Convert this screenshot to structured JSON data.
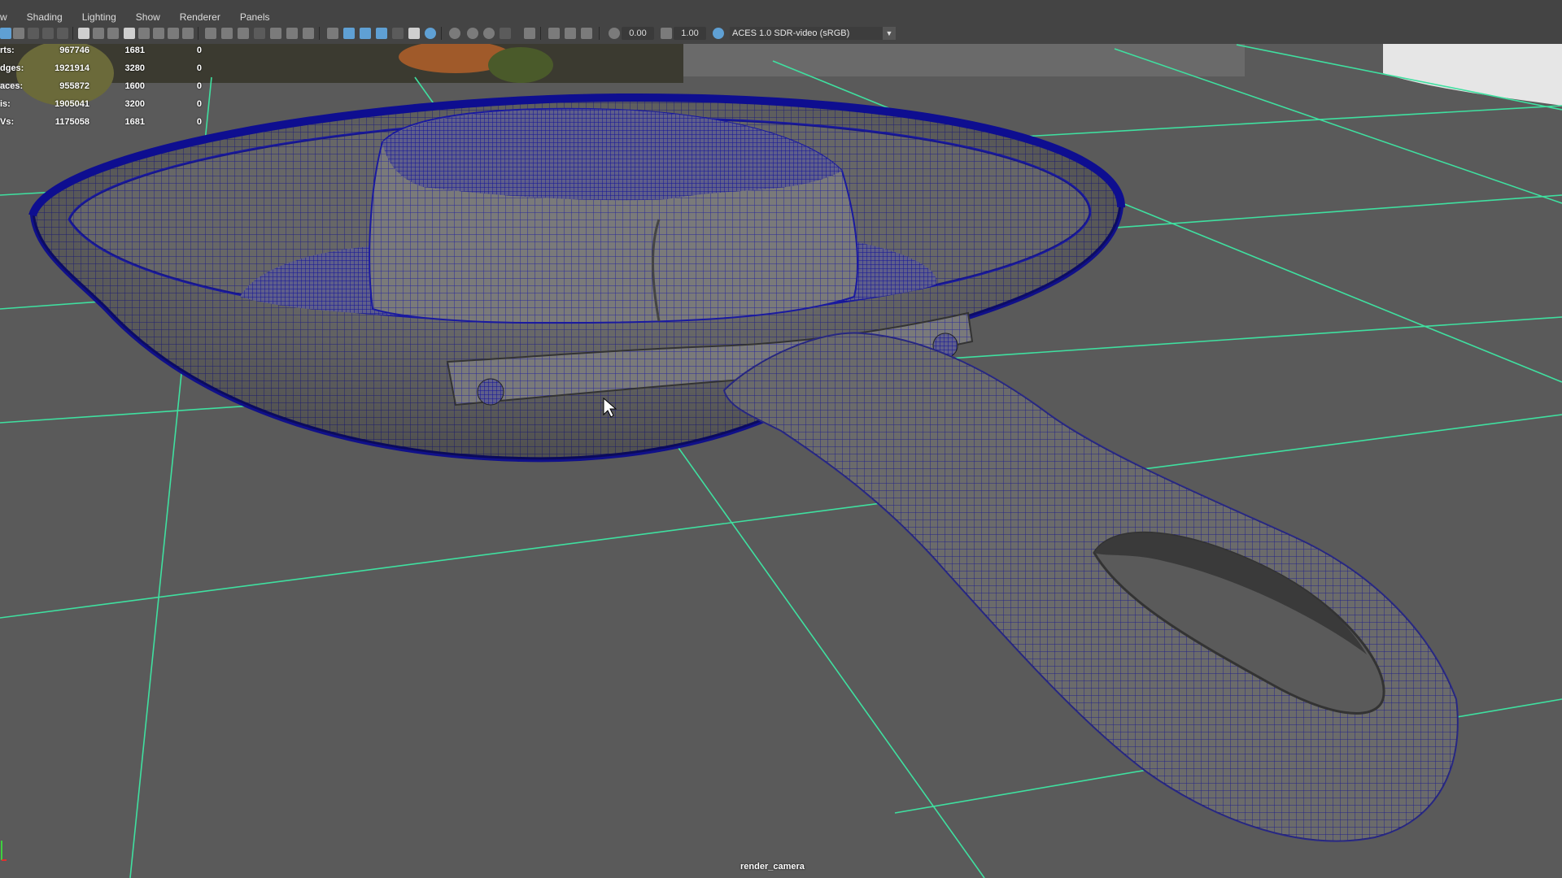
{
  "menu": {
    "items": [
      "w",
      "Shading",
      "Lighting",
      "Show",
      "Renderer",
      "Panels"
    ]
  },
  "toolbar": {
    "exposure": "0.00",
    "gamma": "1.00",
    "color_management": "ACES 1.0 SDR-video (sRGB)"
  },
  "hud": {
    "rows": [
      {
        "label": "rts:",
        "v1": "967746",
        "v2": "1681",
        "v3": "0"
      },
      {
        "label": "dges:",
        "v1": "1921914",
        "v2": "3280",
        "v3": "0"
      },
      {
        "label": "aces:",
        "v1": "955872",
        "v2": "1600",
        "v3": "0"
      },
      {
        "label": "is:",
        "v1": "1905041",
        "v2": "3200",
        "v3": "0"
      },
      {
        "label": "Vs:",
        "v1": "1175058",
        "v2": "1681",
        "v3": "0"
      }
    ]
  },
  "viewport": {
    "camera": "render_camera",
    "grid_color": "#3fe0a0",
    "wire_color": "#1a1aa0",
    "mesh_color": "#7a7a7a",
    "bg_color": "#5a5a5a"
  }
}
